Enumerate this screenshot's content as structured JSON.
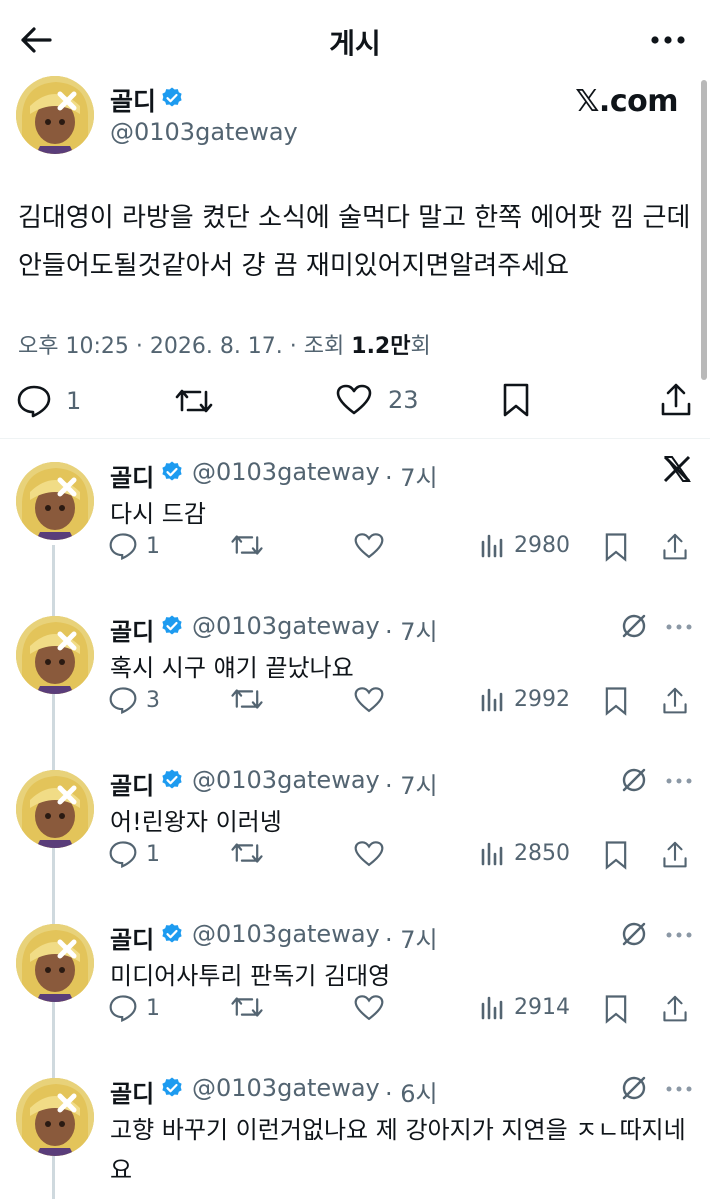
{
  "header": {
    "title": "게시",
    "back_icon": "back-arrow-icon",
    "more_icon": "more-horizontal-icon"
  },
  "main_tweet": {
    "author_name": "골디",
    "handle": "@0103gateway",
    "source_badge": "𝕏.com",
    "text": "김대영이 라방을 켰단 소식에 술먹다 말고 한쪽 에어팟 낌 근데 안들어도될것같아서 걍 끔 재미있어지면알려주세요",
    "meta_time": "오후 10:25 · 2026. 8. 17. · 조회 ",
    "views_bold": "1.2만",
    "views_suffix": "회",
    "replies": "1",
    "likes": "23"
  },
  "replies": [
    {
      "author_name": "골디",
      "handle": "@0103gateway",
      "time": "· 7시",
      "text": "다시 드감",
      "replies": "1",
      "views": "2980"
    },
    {
      "author_name": "골디",
      "handle": "@0103gateway",
      "time": "· 7시",
      "text": "혹시 시구 얘기 끝났나요",
      "replies": "3",
      "views": "2992"
    },
    {
      "author_name": "골디",
      "handle": "@0103gateway",
      "time": "· 7시",
      "text": "어!린왕자 이러넹",
      "replies": "1",
      "views": "2850"
    },
    {
      "author_name": "골디",
      "handle": "@0103gateway",
      "time": "· 7시",
      "text": "미디어사투리 판독기 김대영",
      "replies": "1",
      "views": "2914"
    },
    {
      "author_name": "골디",
      "handle": "@0103gateway",
      "time": "· 6시",
      "text": "고향 바꾸기 이런거없나요 제 강아지가 지연을 ㅈㄴ따지네요"
    }
  ],
  "colors": {
    "verified": "#1d9bf0",
    "secondary_text": "#536471",
    "primary_text": "#0f1419",
    "thread_line": "#cfd9de"
  }
}
